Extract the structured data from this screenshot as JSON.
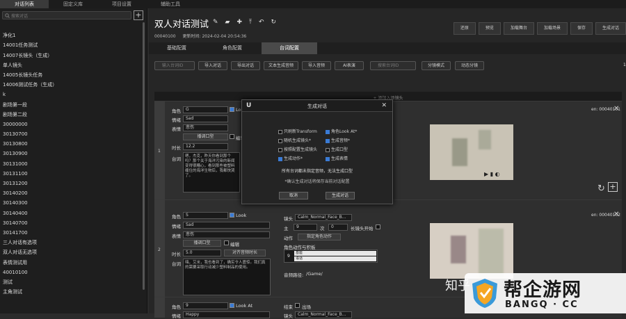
{
  "top_tabs": [
    "对话列表",
    "固定义库",
    "项目设置",
    "辅助工具"
  ],
  "sidebar": {
    "search_placeholder": "搜索对话",
    "add_icon": "plus-icon",
    "items": [
      "",
      "净化1",
      "14001任务测试",
      "14007长镜头（生成）",
      "单人镜头",
      "14005长镜头任务",
      "14006测试任务（生成）",
      "k",
      "剧场第一段",
      "剧场第二段",
      "30000000",
      "30130700",
      "30130800",
      "30130900",
      "30131000",
      "30131100",
      "30131200",
      "30140200",
      "30140300",
      "30140400",
      "30140700",
      "30141700",
      "三人对话有选项",
      "双人对话无选项",
      "表情测试用",
      "40010100",
      "测试",
      "主角测试"
    ]
  },
  "header": {
    "title": "双人对话测试",
    "id": "00040100",
    "updated": "更新时间: 2024-02-04 20:54:36",
    "buttons": [
      "还原",
      "预览",
      "加载舞台",
      "加载场景",
      "保存",
      "生成对话"
    ]
  },
  "subtabs": [
    "基础配置",
    "角色配置",
    "台词配置"
  ],
  "toolbar": {
    "search1": "输入台词ID",
    "b1": "导入对话",
    "b2": "导出对话",
    "b3": "文本生成音频",
    "b4": "导入音频",
    "b5": "AI表演",
    "search2": "搜索台词ID",
    "b6": "分镜模式",
    "b7": "动态分镜",
    "page": "1"
  },
  "add_shot": "+ 添加入场镜头",
  "cards": [
    {
      "index": "1",
      "role": "角色",
      "role_val": "G",
      "look_at": "Look At",
      "mood": "情绪",
      "mood_val": "Sad",
      "expr": "表情",
      "expr_val": "悲伤",
      "mouth_btn": "播调口型",
      "edit": "编辑",
      "dur": "时长",
      "dur_val": "12.2",
      "line": "台词",
      "line_text": "嗯，杰克，昨天你看到那个吗？那个关于海洋污染的新闻变得很糟心，看到那些被塑料缠住的海洋生物后，我都快哭了。",
      "id": "en: 00040101"
    },
    {
      "index": "2",
      "role": "角色",
      "role_val": "S",
      "look_at": "Look",
      "mood": "情绪",
      "mood_val": "Sad",
      "expr": "表情",
      "expr_val": "悲伤",
      "mouth_btn": "播调口型",
      "edit": "编辑",
      "dur": "时长",
      "dur_val": "5.0",
      "dur_btn": "对齐音频时长",
      "line": "台词",
      "line_text": "嗨，艾米，我也看到了，确实令人震惊。我们真的需要采取行动减少塑料制品的使用。",
      "id": "en: 00040102",
      "cam": "镜头",
      "cam_val": "Calm_Normal_Face_B...",
      "main": "主",
      "main_val": "9",
      "next": "次",
      "next_val": "0",
      "long_shot": "长镜头开始",
      "action": "动作",
      "action_btn": "指定角色动作",
      "role_motion": "角色动作与积板",
      "m1": "基座",
      "m2": "语话",
      "audio": "音频路径:",
      "audio_val": "/Game/"
    },
    {
      "role": "角色",
      "role_val": "9",
      "look_at": "Look At",
      "mood": "情绪",
      "mood_val": "Happy",
      "end": "结束",
      "out": "出场",
      "cam": "镜头",
      "cam_val": "Calm_Normal_Face_B..."
    }
  ],
  "modal": {
    "title": "生成对话",
    "options": [
      {
        "label": "只刷新Transform",
        "on": false
      },
      {
        "label": "角色Look At*",
        "on": true
      },
      {
        "label": "随机生成镜头*",
        "on": false
      },
      {
        "label": "生成音频*",
        "on": true
      },
      {
        "label": "按照配置生成镜头",
        "on": false
      },
      {
        "label": "生成口型",
        "on": false
      },
      {
        "label": "生成动作*",
        "on": true
      },
      {
        "label": "生成表情",
        "on": true
      }
    ],
    "note1": "所有台词都未指定音频，无法生成口型",
    "note2": "*确认生成对话将保存当前对话配置",
    "cancel": "取消",
    "confirm": "生成对话"
  },
  "watermark": {
    "zhihu": "知乎",
    "brand": "帮企游网",
    "domain": "BANGQ · CC"
  }
}
